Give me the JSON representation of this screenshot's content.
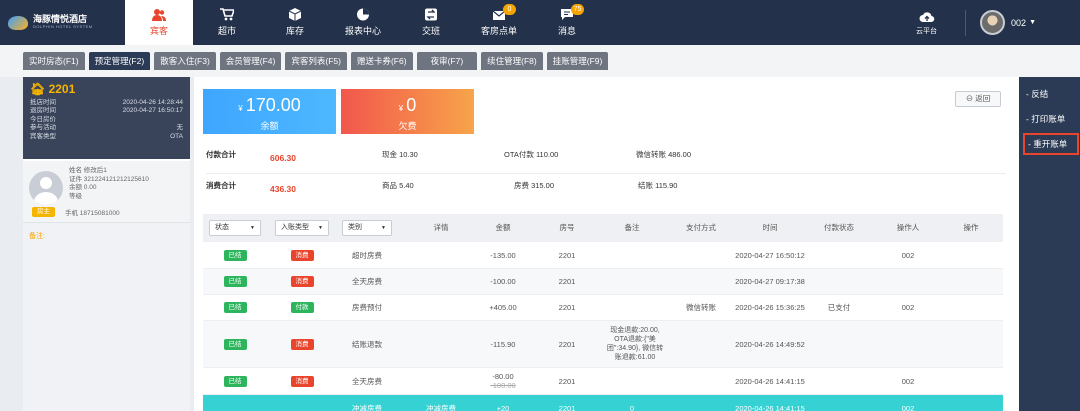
{
  "brand": {
    "name": "海豚情悦酒店",
    "sub": "DOLPHIN HOTEL SYSTEM"
  },
  "nav": [
    {
      "label": "宾客",
      "icon": "guests-icon",
      "active": true
    },
    {
      "label": "超市",
      "icon": "cart-icon"
    },
    {
      "label": "库存",
      "icon": "box-icon"
    },
    {
      "label": "报表中心",
      "icon": "pie-chart-icon"
    },
    {
      "label": "交班",
      "icon": "handover-icon"
    },
    {
      "label": "客房点单",
      "icon": "room-order-icon",
      "badge": "0"
    },
    {
      "label": "消息",
      "icon": "message-icon",
      "badge": "75"
    }
  ],
  "topright": {
    "cloud_label": "云平台",
    "user": "002"
  },
  "tabs": [
    "实时房态(F1)",
    "预定管理(F2)",
    "散客入住(F3)",
    "会员管理(F4)",
    "宾客列表(F5)",
    "赠送卡券(F6)",
    "夜审(F7)",
    "续住管理(F8)",
    "挂账管理(F9)"
  ],
  "room": {
    "number": "2201",
    "rows": [
      {
        "k": "抵店时间",
        "v": "2020-04-26 14:28:44"
      },
      {
        "k": "退房时间",
        "v": "2020-04-27 16:50:17"
      },
      {
        "k": "今日房价",
        "v": ""
      },
      {
        "k": "参与活动",
        "v": "无"
      },
      {
        "k": "宾客类型",
        "v": "OTA"
      }
    ]
  },
  "guest": {
    "name": "姓名 修改后1",
    "id": "证件 321224121212125610",
    "balance": "余额 0.00",
    "level": "等级",
    "tag": "房主",
    "phone": "手机 18715081000"
  },
  "remark_label": "备注:",
  "cards": {
    "balance": {
      "currency": "¥",
      "amount": "170.00",
      "label": "余额"
    },
    "owed": {
      "currency": "¥",
      "amount": "0",
      "label": "欠费"
    }
  },
  "back_label": "返回",
  "payment": {
    "title": "付款合计",
    "total": "606.30",
    "items": [
      "现金 10.30",
      "OTA付款 110.00",
      "微信转账 486.00"
    ]
  },
  "consume": {
    "title": "消费合计",
    "total": "436.30",
    "items": [
      "商品 5.40",
      "房费 315.00",
      "结账 115.90"
    ]
  },
  "table": {
    "filters": [
      "状态",
      "入账类型",
      "类别"
    ],
    "headers": [
      "详情",
      "金额",
      "房号",
      "备注",
      "支付方式",
      "时间",
      "付款状态",
      "操作人",
      "操作"
    ],
    "rows": [
      {
        "status": "已结",
        "type": "消费",
        "category": "超时房费",
        "detail": "",
        "amount": "-135.00",
        "amount_old": "",
        "room": "2201",
        "note": "",
        "pay": "",
        "time": "2020-04-27 16:50:12",
        "paystatus": "",
        "operator": "002"
      },
      {
        "status": "已结",
        "type": "消费",
        "category": "全天房费",
        "detail": "",
        "amount": "-100.00",
        "amount_old": "",
        "room": "2201",
        "note": "",
        "pay": "",
        "time": "2020-04-27 09:17:38",
        "paystatus": "",
        "operator": ""
      },
      {
        "status": "已结",
        "type": "付款",
        "category": "房费预付",
        "detail": "",
        "amount": "+405.00",
        "amount_old": "",
        "room": "2201",
        "note": "",
        "pay": "微信转账",
        "time": "2020-04-26 15:36:25",
        "paystatus": "已支付",
        "operator": "002"
      },
      {
        "status": "已结",
        "type": "消费",
        "category": "结账退款",
        "detail": "",
        "amount": "-115.90",
        "amount_old": "",
        "room": "2201",
        "note": "现金退款:20.00, OTA退款:{\"美团\":34.90}, 微信转账退款:61.00",
        "pay": "",
        "time": "2020-04-26 14:49:52",
        "paystatus": "",
        "operator": ""
      },
      {
        "status": "已结",
        "type": "消费",
        "category": "全天房费",
        "detail": "",
        "amount": "-80.00",
        "amount_old": "-100.00",
        "room": "2201",
        "note": "",
        "pay": "",
        "time": "2020-04-26 14:41:15",
        "paystatus": "",
        "operator": "002"
      },
      {
        "status": "",
        "type": "",
        "category": "冲减房费",
        "detail": "冲减房费",
        "amount": "+20",
        "amount_old": "",
        "room": "2201",
        "note": "0",
        "pay": "",
        "time": "2020-04-26 14:41:15",
        "paystatus": "",
        "operator": "002"
      }
    ]
  },
  "actions": [
    "- 反结",
    "- 打印账单",
    "- 重开账单"
  ]
}
